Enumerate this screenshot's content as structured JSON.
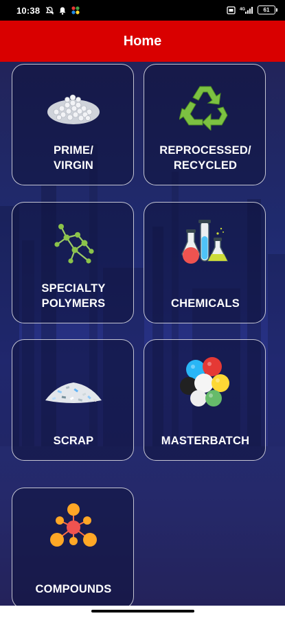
{
  "status_bar": {
    "time": "10:38",
    "battery_level": "61"
  },
  "app_bar": {
    "title": "Home"
  },
  "tiles": [
    {
      "label": "PRIME/\nVIRGIN",
      "icon": "pellets-icon"
    },
    {
      "label": "REPROCESSED/\nRECYCLED",
      "icon": "recycle-icon"
    },
    {
      "label": "SPECIALTY\nPOLYMERS",
      "icon": "molecule-icon"
    },
    {
      "label": "CHEMICALS",
      "icon": "flasks-icon"
    },
    {
      "label": "SCRAP",
      "icon": "scrap-icon"
    },
    {
      "label": "MASTERBATCH",
      "icon": "masterbatch-icon"
    },
    {
      "label": "COMPOUNDS",
      "icon": "compounds-icon"
    }
  ],
  "colors": {
    "app_bar": "#d90000",
    "background": "#242a6c",
    "tile_border": "#ffffff"
  }
}
